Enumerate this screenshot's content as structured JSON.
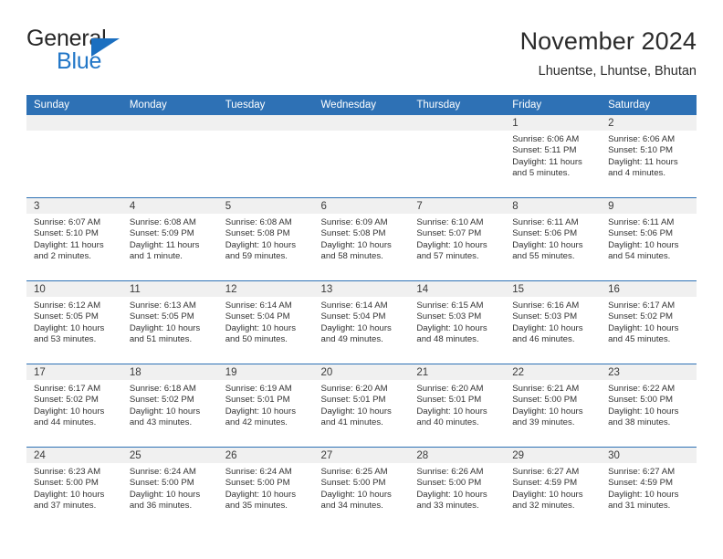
{
  "brand": {
    "name_part1": "General",
    "name_part2": "Blue"
  },
  "header": {
    "title": "November 2024",
    "subtitle": "Lhuentse, Lhuntse, Bhutan"
  },
  "weekday_headers": [
    "Sunday",
    "Monday",
    "Tuesday",
    "Wednesday",
    "Thursday",
    "Friday",
    "Saturday"
  ],
  "colors": {
    "header_blue": "#2e71b5",
    "brand_blue": "#2176c7",
    "daynum_band": "#f0f0f0",
    "text": "#333333"
  },
  "labels": {
    "sunrise_prefix": "Sunrise:",
    "sunset_prefix": "Sunset:",
    "daylight_prefix": "Daylight:"
  },
  "weeks": [
    {
      "days": [
        {
          "empty": true
        },
        {
          "empty": true
        },
        {
          "empty": true
        },
        {
          "empty": true
        },
        {
          "empty": true
        },
        {
          "date": "1",
          "sunrise": "Sunrise: 6:06 AM",
          "sunset": "Sunset: 5:11 PM",
          "daylight_line1": "Daylight: 11 hours",
          "daylight_line2": "and 5 minutes."
        },
        {
          "date": "2",
          "sunrise": "Sunrise: 6:06 AM",
          "sunset": "Sunset: 5:10 PM",
          "daylight_line1": "Daylight: 11 hours",
          "daylight_line2": "and 4 minutes."
        }
      ]
    },
    {
      "days": [
        {
          "date": "3",
          "sunrise": "Sunrise: 6:07 AM",
          "sunset": "Sunset: 5:10 PM",
          "daylight_line1": "Daylight: 11 hours",
          "daylight_line2": "and 2 minutes."
        },
        {
          "date": "4",
          "sunrise": "Sunrise: 6:08 AM",
          "sunset": "Sunset: 5:09 PM",
          "daylight_line1": "Daylight: 11 hours",
          "daylight_line2": "and 1 minute."
        },
        {
          "date": "5",
          "sunrise": "Sunrise: 6:08 AM",
          "sunset": "Sunset: 5:08 PM",
          "daylight_line1": "Daylight: 10 hours",
          "daylight_line2": "and 59 minutes."
        },
        {
          "date": "6",
          "sunrise": "Sunrise: 6:09 AM",
          "sunset": "Sunset: 5:08 PM",
          "daylight_line1": "Daylight: 10 hours",
          "daylight_line2": "and 58 minutes."
        },
        {
          "date": "7",
          "sunrise": "Sunrise: 6:10 AM",
          "sunset": "Sunset: 5:07 PM",
          "daylight_line1": "Daylight: 10 hours",
          "daylight_line2": "and 57 minutes."
        },
        {
          "date": "8",
          "sunrise": "Sunrise: 6:11 AM",
          "sunset": "Sunset: 5:06 PM",
          "daylight_line1": "Daylight: 10 hours",
          "daylight_line2": "and 55 minutes."
        },
        {
          "date": "9",
          "sunrise": "Sunrise: 6:11 AM",
          "sunset": "Sunset: 5:06 PM",
          "daylight_line1": "Daylight: 10 hours",
          "daylight_line2": "and 54 minutes."
        }
      ]
    },
    {
      "days": [
        {
          "date": "10",
          "sunrise": "Sunrise: 6:12 AM",
          "sunset": "Sunset: 5:05 PM",
          "daylight_line1": "Daylight: 10 hours",
          "daylight_line2": "and 53 minutes."
        },
        {
          "date": "11",
          "sunrise": "Sunrise: 6:13 AM",
          "sunset": "Sunset: 5:05 PM",
          "daylight_line1": "Daylight: 10 hours",
          "daylight_line2": "and 51 minutes."
        },
        {
          "date": "12",
          "sunrise": "Sunrise: 6:14 AM",
          "sunset": "Sunset: 5:04 PM",
          "daylight_line1": "Daylight: 10 hours",
          "daylight_line2": "and 50 minutes."
        },
        {
          "date": "13",
          "sunrise": "Sunrise: 6:14 AM",
          "sunset": "Sunset: 5:04 PM",
          "daylight_line1": "Daylight: 10 hours",
          "daylight_line2": "and 49 minutes."
        },
        {
          "date": "14",
          "sunrise": "Sunrise: 6:15 AM",
          "sunset": "Sunset: 5:03 PM",
          "daylight_line1": "Daylight: 10 hours",
          "daylight_line2": "and 48 minutes."
        },
        {
          "date": "15",
          "sunrise": "Sunrise: 6:16 AM",
          "sunset": "Sunset: 5:03 PM",
          "daylight_line1": "Daylight: 10 hours",
          "daylight_line2": "and 46 minutes."
        },
        {
          "date": "16",
          "sunrise": "Sunrise: 6:17 AM",
          "sunset": "Sunset: 5:02 PM",
          "daylight_line1": "Daylight: 10 hours",
          "daylight_line2": "and 45 minutes."
        }
      ]
    },
    {
      "days": [
        {
          "date": "17",
          "sunrise": "Sunrise: 6:17 AM",
          "sunset": "Sunset: 5:02 PM",
          "daylight_line1": "Daylight: 10 hours",
          "daylight_line2": "and 44 minutes."
        },
        {
          "date": "18",
          "sunrise": "Sunrise: 6:18 AM",
          "sunset": "Sunset: 5:02 PM",
          "daylight_line1": "Daylight: 10 hours",
          "daylight_line2": "and 43 minutes."
        },
        {
          "date": "19",
          "sunrise": "Sunrise: 6:19 AM",
          "sunset": "Sunset: 5:01 PM",
          "daylight_line1": "Daylight: 10 hours",
          "daylight_line2": "and 42 minutes."
        },
        {
          "date": "20",
          "sunrise": "Sunrise: 6:20 AM",
          "sunset": "Sunset: 5:01 PM",
          "daylight_line1": "Daylight: 10 hours",
          "daylight_line2": "and 41 minutes."
        },
        {
          "date": "21",
          "sunrise": "Sunrise: 6:20 AM",
          "sunset": "Sunset: 5:01 PM",
          "daylight_line1": "Daylight: 10 hours",
          "daylight_line2": "and 40 minutes."
        },
        {
          "date": "22",
          "sunrise": "Sunrise: 6:21 AM",
          "sunset": "Sunset: 5:00 PM",
          "daylight_line1": "Daylight: 10 hours",
          "daylight_line2": "and 39 minutes."
        },
        {
          "date": "23",
          "sunrise": "Sunrise: 6:22 AM",
          "sunset": "Sunset: 5:00 PM",
          "daylight_line1": "Daylight: 10 hours",
          "daylight_line2": "and 38 minutes."
        }
      ]
    },
    {
      "days": [
        {
          "date": "24",
          "sunrise": "Sunrise: 6:23 AM",
          "sunset": "Sunset: 5:00 PM",
          "daylight_line1": "Daylight: 10 hours",
          "daylight_line2": "and 37 minutes."
        },
        {
          "date": "25",
          "sunrise": "Sunrise: 6:24 AM",
          "sunset": "Sunset: 5:00 PM",
          "daylight_line1": "Daylight: 10 hours",
          "daylight_line2": "and 36 minutes."
        },
        {
          "date": "26",
          "sunrise": "Sunrise: 6:24 AM",
          "sunset": "Sunset: 5:00 PM",
          "daylight_line1": "Daylight: 10 hours",
          "daylight_line2": "and 35 minutes."
        },
        {
          "date": "27",
          "sunrise": "Sunrise: 6:25 AM",
          "sunset": "Sunset: 5:00 PM",
          "daylight_line1": "Daylight: 10 hours",
          "daylight_line2": "and 34 minutes."
        },
        {
          "date": "28",
          "sunrise": "Sunrise: 6:26 AM",
          "sunset": "Sunset: 5:00 PM",
          "daylight_line1": "Daylight: 10 hours",
          "daylight_line2": "and 33 minutes."
        },
        {
          "date": "29",
          "sunrise": "Sunrise: 6:27 AM",
          "sunset": "Sunset: 4:59 PM",
          "daylight_line1": "Daylight: 10 hours",
          "daylight_line2": "and 32 minutes."
        },
        {
          "date": "30",
          "sunrise": "Sunrise: 6:27 AM",
          "sunset": "Sunset: 4:59 PM",
          "daylight_line1": "Daylight: 10 hours",
          "daylight_line2": "and 31 minutes."
        }
      ]
    }
  ]
}
